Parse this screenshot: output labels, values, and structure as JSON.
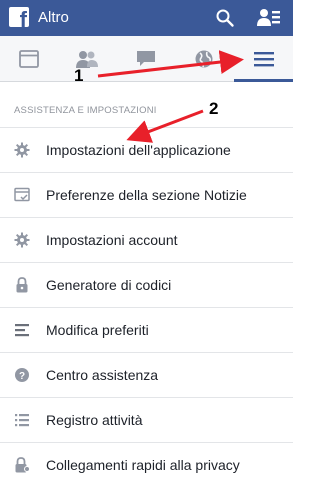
{
  "header": {
    "title": "Altro",
    "logo_icon": "facebook-logo-icon",
    "search_icon": "search-icon",
    "friend_requests_icon": "friend-requests-icon",
    "color": "#3b5998"
  },
  "tabs": [
    {
      "icon": "news-feed-icon"
    },
    {
      "icon": "friends-icon"
    },
    {
      "icon": "messages-icon"
    },
    {
      "icon": "notifications-globe-icon"
    },
    {
      "icon": "menu-icon",
      "active": true
    }
  ],
  "section": {
    "title": "ASSISTENZA E IMPOSTAZIONI"
  },
  "menu_items": [
    {
      "label": "Impostazioni dell'applicazione",
      "icon": "gear-icon"
    },
    {
      "label": "Preferenze della sezione Notizie",
      "icon": "news-feed-preferences-icon"
    },
    {
      "label": "Impostazioni account",
      "icon": "gear-icon"
    },
    {
      "label": "Generatore di codici",
      "icon": "lock-icon"
    },
    {
      "label": "Modifica preferiti",
      "icon": "lines-icon"
    },
    {
      "label": "Centro assistenza",
      "icon": "help-icon"
    },
    {
      "label": "Registro attività",
      "icon": "list-icon"
    },
    {
      "label": "Collegamenti rapidi alla privacy",
      "icon": "privacy-lock-icon"
    }
  ],
  "annotations": [
    {
      "label": "1"
    },
    {
      "label": "2"
    }
  ],
  "annotation_color": "#e8202a"
}
